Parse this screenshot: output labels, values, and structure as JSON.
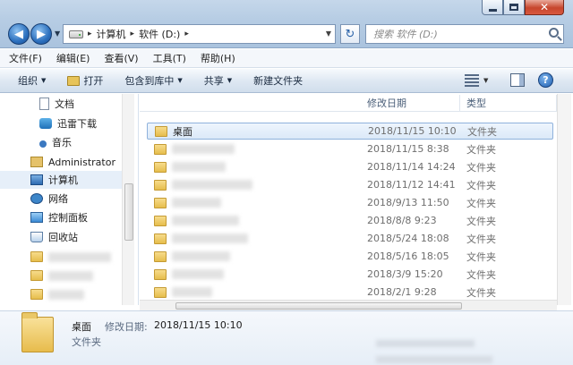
{
  "window": {
    "controls": {
      "minimize_icon": "minimize-icon",
      "maximize_icon": "maximize-icon",
      "close_glyph": "✕"
    }
  },
  "address": {
    "crumbs": [
      "计算机",
      "软件 (D:)"
    ],
    "search_placeholder": "搜索 软件 (D:)"
  },
  "menu": [
    "文件(F)",
    "编辑(E)",
    "查看(V)",
    "工具(T)",
    "帮助(H)"
  ],
  "commands": {
    "organize": "组织",
    "open": "打开",
    "include": "包含到库中",
    "share": "共享",
    "new_folder": "新建文件夹"
  },
  "nav": {
    "items": [
      "文档",
      "迅雷下载",
      "音乐",
      "Administrator",
      "计算机",
      "网络",
      "控制面板",
      "回收站"
    ]
  },
  "columns": {
    "modified": "修改日期",
    "type": "类型"
  },
  "files": [
    {
      "name": "桌面",
      "date": "2018/11/15 10:10",
      "type": "文件夹"
    },
    {
      "name": "",
      "date": "2018/11/15 8:38",
      "type": "文件夹"
    },
    {
      "name": "",
      "date": "2018/11/14 14:24",
      "type": "文件夹"
    },
    {
      "name": "",
      "date": "2018/11/12 14:41",
      "type": "文件夹"
    },
    {
      "name": "",
      "date": "2018/9/13 11:50",
      "type": "文件夹"
    },
    {
      "name": "",
      "date": "2018/8/8 9:23",
      "type": "文件夹"
    },
    {
      "name": "",
      "date": "2018/5/24 18:08",
      "type": "文件夹"
    },
    {
      "name": "",
      "date": "2018/5/16 18:05",
      "type": "文件夹"
    },
    {
      "name": "",
      "date": "2018/3/9 15:20",
      "type": "文件夹"
    },
    {
      "name": "",
      "date": "2018/2/1 9:28",
      "type": "文件夹"
    }
  ],
  "details": {
    "name": "桌面",
    "modified_label": "修改日期:",
    "modified_value": "2018/11/15 10:10",
    "type": "文件夹"
  }
}
